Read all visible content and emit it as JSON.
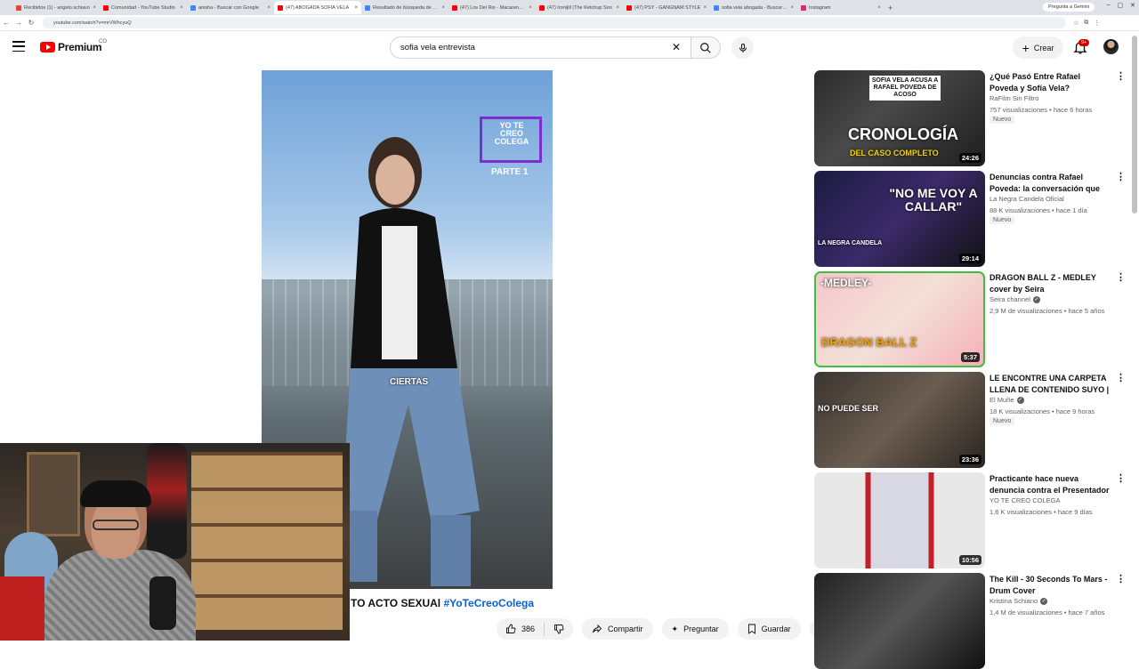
{
  "browser": {
    "tabs": [
      {
        "label": "Recibidos (1) - angelo.schiavo",
        "color": "#ea4335"
      },
      {
        "label": "Comunidad - YouTube Studio",
        "color": "#ff0000"
      },
      {
        "label": "anisha - Buscar con Google",
        "color": "#4285f4"
      },
      {
        "label": "(47) ABOGADA SOFIA VELA",
        "color": "#ff0000",
        "active": true
      },
      {
        "label": "Resultado de búsqueda de mo",
        "color": "#4285f4"
      },
      {
        "label": "(47) Los Del Rio - Macarena (B",
        "color": "#ff0000"
      },
      {
        "label": "(47) Ironijill (The Ketchup Son",
        "color": "#ff0000"
      },
      {
        "label": "(47) PSY - GANGNAM STYLE",
        "color": "#ff0000"
      },
      {
        "label": "sofia vela abogada - Buscar co",
        "color": "#4285f4"
      },
      {
        "label": "Instagram",
        "color": "#d62976"
      }
    ],
    "new_tab": "+",
    "gemini_label": "Pregunta a Gemini",
    "url": "youtube.com/watch?v=mrVWhcyuQ"
  },
  "header": {
    "logo_text": "Premium",
    "country": "CO",
    "search_query": "sofia vela entrevista",
    "create_label": "Crear",
    "notif_count": "9+"
  },
  "player": {
    "overlay_title": "YO TE CREO COLEGA",
    "overlay_part": "PARTE 1",
    "caption": "CIERTAS"
  },
  "video": {
    "title_prefix": "TO ACTO SEXUAl ",
    "hashtag": "#YoTeCreoColega",
    "likes": "386",
    "share_label": "Compartir",
    "ask_label": "Preguntar",
    "save_label": "Guardar"
  },
  "recommendations": [
    {
      "title": "¿Qué Pasó Entre Rafael Poveda y Sofía Vela? Cronología del Caso ...",
      "channel": "RaFilm Sin Filtro",
      "verified": false,
      "views": "757 visualizaciones",
      "age": "hace 6 horas",
      "badge": "Nuevo",
      "duration": "24:26",
      "thumb_text": "CRONOLOGÍA",
      "thumb_sub": "DEL CASO COMPLETO",
      "thumb_tag": "SOFIA VELA ACUSA A RAFAEL POVEDA DE ACOSO"
    },
    {
      "title": "Denuncias contra Rafael Poveda: la conversación que encendió el ...",
      "channel": "La Negra Candela Oficial",
      "verified": false,
      "views": "88 K visualizaciones",
      "age": "hace 1 día",
      "badge": "Nuevo",
      "duration": "29:14",
      "thumb_text": "\"NO ME VOY A CALLAR\"",
      "thumb_sub": "LA NEGRA CANDELA",
      "thumb_tag": ""
    },
    {
      "title": "DRAGON BALL Z - MEDLEY cover by Seira",
      "channel": "Seira channel",
      "verified": true,
      "views": "2,9 M de visualizaciones",
      "age": "hace 5 años",
      "badge": "",
      "duration": "5:37",
      "thumb_text": "-MEDLEY-",
      "thumb_sub": "DRAGON BALL Z",
      "thumb_tag": ""
    },
    {
      "title": "LE ENCONTRE UNA CARPETA LLENA DE CONTENIDO SUYO | ...",
      "channel": "El Muñe",
      "verified": true,
      "views": "18 K visualizaciones",
      "age": "hace 9 horas",
      "badge": "Nuevo",
      "duration": "23:36",
      "thumb_text": "NO PUEDE SER",
      "thumb_sub": "",
      "thumb_tag": ""
    },
    {
      "title": "Practicante hace nueva denuncia contra el Presentador y Periodist...",
      "channel": "YO TE CREO COLEGA",
      "verified": false,
      "views": "1,6 K visualizaciones",
      "age": "hace 9 días",
      "badge": "",
      "duration": "10:56",
      "thumb_text": "",
      "thumb_sub": "",
      "thumb_tag": ""
    },
    {
      "title": "The Kill - 30 Seconds To Mars - Drum Cover",
      "channel": "Kristina Schiano",
      "verified": true,
      "views": "1,4 M de visualizaciones",
      "age": "hace 7 años",
      "badge": "",
      "duration": "",
      "thumb_text": "",
      "thumb_sub": "",
      "thumb_tag": ""
    }
  ]
}
